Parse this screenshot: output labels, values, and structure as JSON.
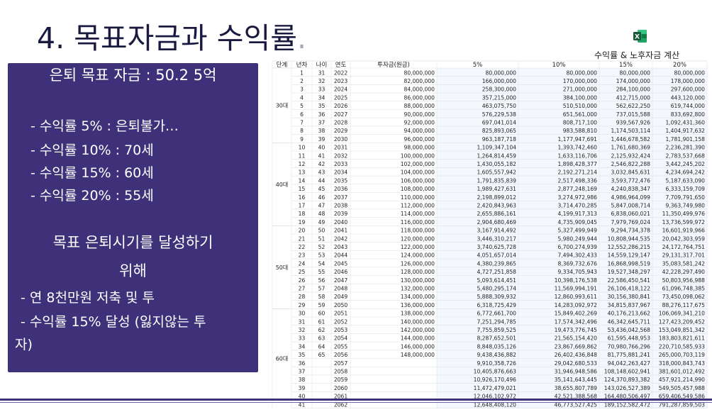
{
  "slide": {
    "title": "4. 목표자금과 수익률",
    "title_dot": ".",
    "calc_label": "수익률 & 노후자금 계산",
    "excel_icon_letter": "X"
  },
  "panel": {
    "goal": "은퇴 목표 자금 : 50.2 5억",
    "rates": [
      "- 수익률 5% : 은퇴불가…",
      "- 수익률 10% : 70세",
      "- 수익률 15% : 60세",
      "- 수익률 20% : 55세"
    ],
    "heading_line1": "목표 은퇴시기를 달성하기",
    "heading_line2": "위해",
    "bullet1": "- 연 8천만원 저축 및 투",
    "bullet2": "- 수익률 15% 달성 (잃지않는 투",
    "bullet2_cont": "자)"
  },
  "spreadsheet": {
    "headers": [
      "단계",
      "년차",
      "나이",
      "연도",
      "투자금(원금)",
      "5%",
      "10%",
      "15%",
      "20%"
    ],
    "groups": [
      {
        "label": "30대",
        "start": 0,
        "count": 9
      },
      {
        "label": "40대",
        "start": 9,
        "count": 10
      },
      {
        "label": "50대",
        "start": 19,
        "count": 10
      },
      {
        "label": "60대",
        "start": 29,
        "count": 12
      }
    ],
    "rows": [
      [
        "1",
        "31",
        "2022",
        "80,000,000",
        "80,000,000",
        "80,000,000",
        "80,000,000",
        "80,000,000"
      ],
      [
        "2",
        "32",
        "2023",
        "82,000,000",
        "166,000,000",
        "170,000,000",
        "174,000,000",
        "178,000,000"
      ],
      [
        "3",
        "33",
        "2024",
        "84,000,000",
        "258,300,000",
        "271,000,000",
        "284,100,000",
        "297,600,000"
      ],
      [
        "4",
        "34",
        "2025",
        "86,000,000",
        "357,215,000",
        "384,100,000",
        "412,715,000",
        "443,120,000"
      ],
      [
        "5",
        "35",
        "2026",
        "88,000,000",
        "463,075,750",
        "510,510,000",
        "562,622,250",
        "619,744,000"
      ],
      [
        "6",
        "36",
        "2027",
        "90,000,000",
        "576,229,538",
        "651,561,000",
        "737,015,588",
        "833,692,800"
      ],
      [
        "7",
        "37",
        "2028",
        "92,000,000",
        "697,041,014",
        "808,717,100",
        "939,567,926",
        "1,092,431,360"
      ],
      [
        "8",
        "38",
        "2029",
        "94,000,000",
        "825,893,065",
        "983,588,810",
        "1,174,503,114",
        "1,404,917,632"
      ],
      [
        "9",
        "39",
        "2030",
        "96,000,000",
        "963,187,718",
        "1,177,947,691",
        "1,446,678,582",
        "1,781,901,158"
      ],
      [
        "10",
        "40",
        "2031",
        "98,000,000",
        "1,109,347,104",
        "1,393,742,460",
        "1,761,680,369",
        "2,236,281,390"
      ],
      [
        "11",
        "41",
        "2032",
        "100,000,000",
        "1,264,814,459",
        "1,633,116,706",
        "2,125,932,424",
        "2,783,537,668"
      ],
      [
        "12",
        "42",
        "2033",
        "102,000,000",
        "1,430,055,182",
        "1,898,428,377",
        "2,546,822,288",
        "3,442,245,202"
      ],
      [
        "13",
        "43",
        "2034",
        "104,000,000",
        "1,605,557,942",
        "2,192,271,214",
        "3,032,845,631",
        "4,234,694,242"
      ],
      [
        "14",
        "44",
        "2035",
        "106,000,000",
        "1,791,835,839",
        "2,517,498,336",
        "3,593,772,476",
        "5,187,633,090"
      ],
      [
        "15",
        "45",
        "2036",
        "108,000,000",
        "1,989,427,631",
        "2,877,248,169",
        "4,240,838,347",
        "6,333,159,709"
      ],
      [
        "16",
        "46",
        "2037",
        "110,000,000",
        "2,198,899,012",
        "3,274,972,986",
        "4,986,964,099",
        "7,709,791,650"
      ],
      [
        "17",
        "47",
        "2038",
        "112,000,000",
        "2,420,843,963",
        "3,714,470,285",
        "5,847,008,714",
        "9,363,749,980"
      ],
      [
        "18",
        "48",
        "2039",
        "114,000,000",
        "2,655,886,161",
        "4,199,917,313",
        "6,838,060,021",
        "11,350,499,976"
      ],
      [
        "19",
        "49",
        "2040",
        "116,000,000",
        "2,904,680,469",
        "4,735,909,045",
        "7,979,769,024",
        "13,736,599,972"
      ],
      [
        "20",
        "50",
        "2041",
        "118,000,000",
        "3,167,914,492",
        "5,327,499,949",
        "9,294,734,378",
        "16,601,919,966"
      ],
      [
        "21",
        "51",
        "2042",
        "120,000,000",
        "3,446,310,217",
        "5,980,249,944",
        "10,808,944,535",
        "20,042,303,959"
      ],
      [
        "22",
        "52",
        "2043",
        "122,000,000",
        "3,740,625,728",
        "6,700,274,939",
        "12,552,286,215",
        "24,172,764,751"
      ],
      [
        "23",
        "53",
        "2044",
        "124,000,000",
        "4,051,657,014",
        "7,494,302,433",
        "14,559,129,147",
        "29,131,317,701"
      ],
      [
        "24",
        "54",
        "2045",
        "126,000,000",
        "4,380,239,865",
        "8,369,732,676",
        "16,868,998,519",
        "35,083,581,242"
      ],
      [
        "25",
        "55",
        "2046",
        "128,000,000",
        "4,727,251,858",
        "9,334,705,943",
        "19,527,348,297",
        "42,228,297,490"
      ],
      [
        "26",
        "56",
        "2047",
        "130,000,000",
        "5,093,614,451",
        "10,398,176,538",
        "22,586,450,541",
        "50,803,956,988"
      ],
      [
        "27",
        "57",
        "2048",
        "132,000,000",
        "5,480,295,174",
        "11,569,994,191",
        "26,106,418,122",
        "61,096,748,385"
      ],
      [
        "28",
        "58",
        "2049",
        "134,000,000",
        "5,888,309,932",
        "12,860,993,611",
        "30,156,380,841",
        "73,450,098,062"
      ],
      [
        "29",
        "59",
        "2050",
        "136,000,000",
        "6,318,725,429",
        "14,283,092,972",
        "34,815,837,967",
        "88,276,117,675"
      ],
      [
        "30",
        "60",
        "2051",
        "138,000,000",
        "6,772,661,700",
        "15,849,402,269",
        "40,176,213,662",
        "106,069,341,210"
      ],
      [
        "31",
        "61",
        "2052",
        "140,000,000",
        "7,251,294,785",
        "17,574,342,496",
        "46,342,645,711",
        "127,423,209,452"
      ],
      [
        "32",
        "62",
        "2053",
        "142,000,000",
        "7,755,859,525",
        "19,473,776,745",
        "53,436,042,568",
        "153,049,851,342"
      ],
      [
        "33",
        "63",
        "2054",
        "144,000,000",
        "8,287,652,501",
        "21,565,154,420",
        "61,595,448,953",
        "183,803,821,611"
      ],
      [
        "34",
        "64",
        "2055",
        "146,000,000",
        "8,848,035,126",
        "23,867,669,862",
        "70,980,766,296",
        "220,710,585,933"
      ],
      [
        "35",
        "65",
        "2056",
        "148,000,000",
        "9,438,436,882",
        "26,402,436,848",
        "81,775,881,241",
        "265,000,703,119"
      ],
      [
        "36",
        "",
        "2057",
        "",
        "9,910,358,726",
        "29,042,680,533",
        "94,042,263,427",
        "318,000,843,743"
      ],
      [
        "37",
        "",
        "2058",
        "",
        "10,405,876,663",
        "31,946,948,586",
        "108,148,602,941",
        "381,601,012,492"
      ],
      [
        "38",
        "",
        "2059",
        "",
        "10,926,170,496",
        "35,141,643,445",
        "124,370,893,382",
        "457,921,214,990"
      ],
      [
        "39",
        "",
        "2060",
        "",
        "11,472,479,021",
        "38,655,807,789",
        "143,026,527,389",
        "549,505,457,988"
      ],
      [
        "40",
        "",
        "2061",
        "",
        "12,046,102,972",
        "42,521,388,568",
        "164,480,506,497",
        "659,406,549,586"
      ],
      [
        "41",
        "",
        "2062",
        "",
        "12,648,408,120",
        "46,773,527,425",
        "189,152,582,472",
        "791,287,859,503"
      ]
    ]
  }
}
